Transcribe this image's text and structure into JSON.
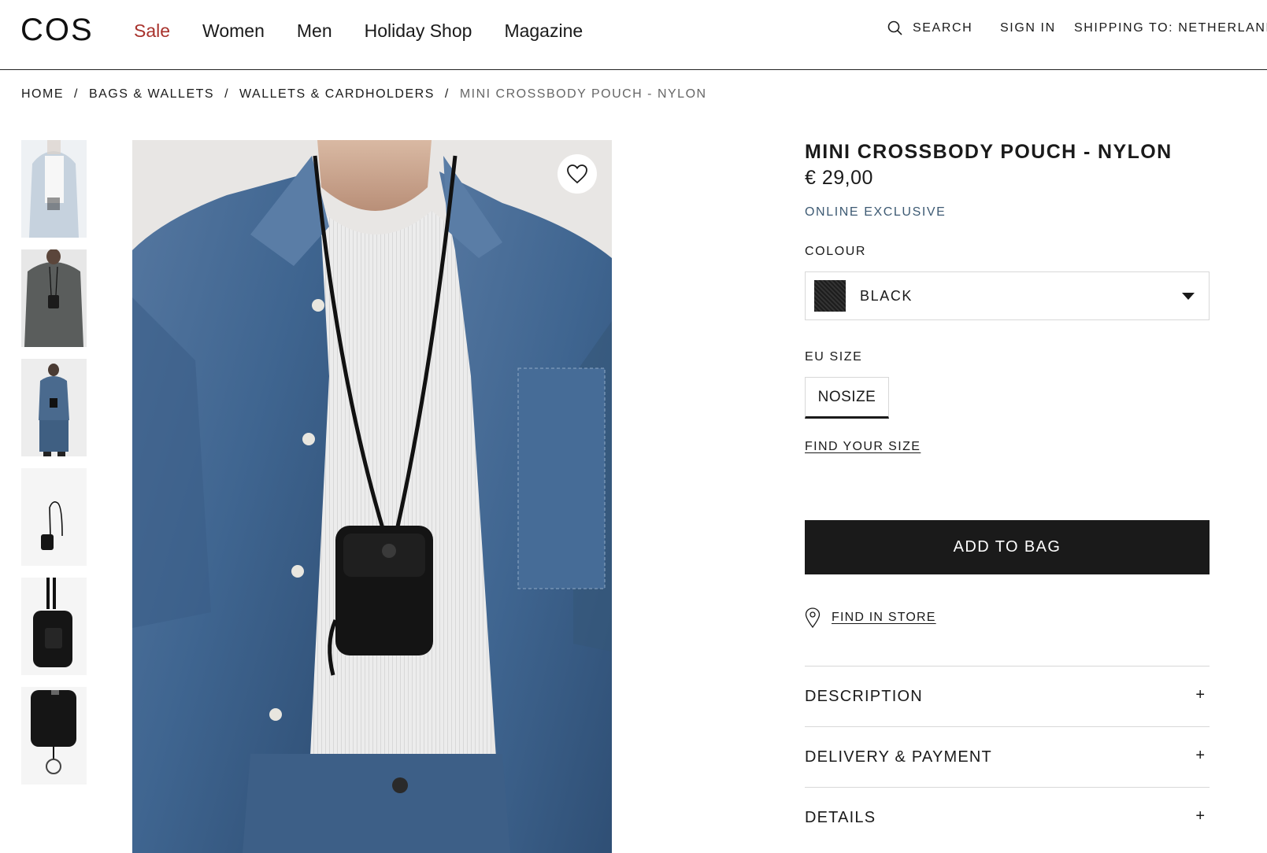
{
  "header": {
    "logo": "COS",
    "nav": [
      "Sale",
      "Women",
      "Men",
      "Holiday Shop",
      "Magazine"
    ],
    "search_label": "SEARCH",
    "signin_label": "SIGN IN",
    "shipping_label": "SHIPPING TO: NETHERLANDS"
  },
  "breadcrumb": {
    "items": [
      "HOME",
      "BAGS & WALLETS",
      "WALLETS & CARDHOLDERS"
    ],
    "separator": "/",
    "current": "MINI CROSSBODY POUCH - NYLON"
  },
  "product": {
    "title": "MINI CROSSBODY POUCH - NYLON",
    "price": "€ 29,00",
    "badge": "ONLINE EXCLUSIVE",
    "colour_label": "COLOUR",
    "colour_value": "BLACK",
    "size_label": "EU SIZE",
    "size_value": "NOSIZE",
    "find_size": "FIND YOUR SIZE",
    "add_to_bag": "ADD TO BAG",
    "find_in_store": "FIND IN STORE"
  },
  "accordion": [
    {
      "label": "DESCRIPTION",
      "icon": "+"
    },
    {
      "label": "DELIVERY & PAYMENT",
      "icon": "+"
    },
    {
      "label": "DETAILS",
      "icon": "+"
    }
  ],
  "colors": {
    "sale": "#a8322c",
    "exclusive": "#3d5a73",
    "button": "#1a1a1a",
    "denim": "#4a6a8e"
  },
  "icons": {
    "search": "search-icon",
    "wishlist": "heart-icon",
    "store": "location-pin-icon",
    "dropdown": "chevron-down-icon"
  }
}
